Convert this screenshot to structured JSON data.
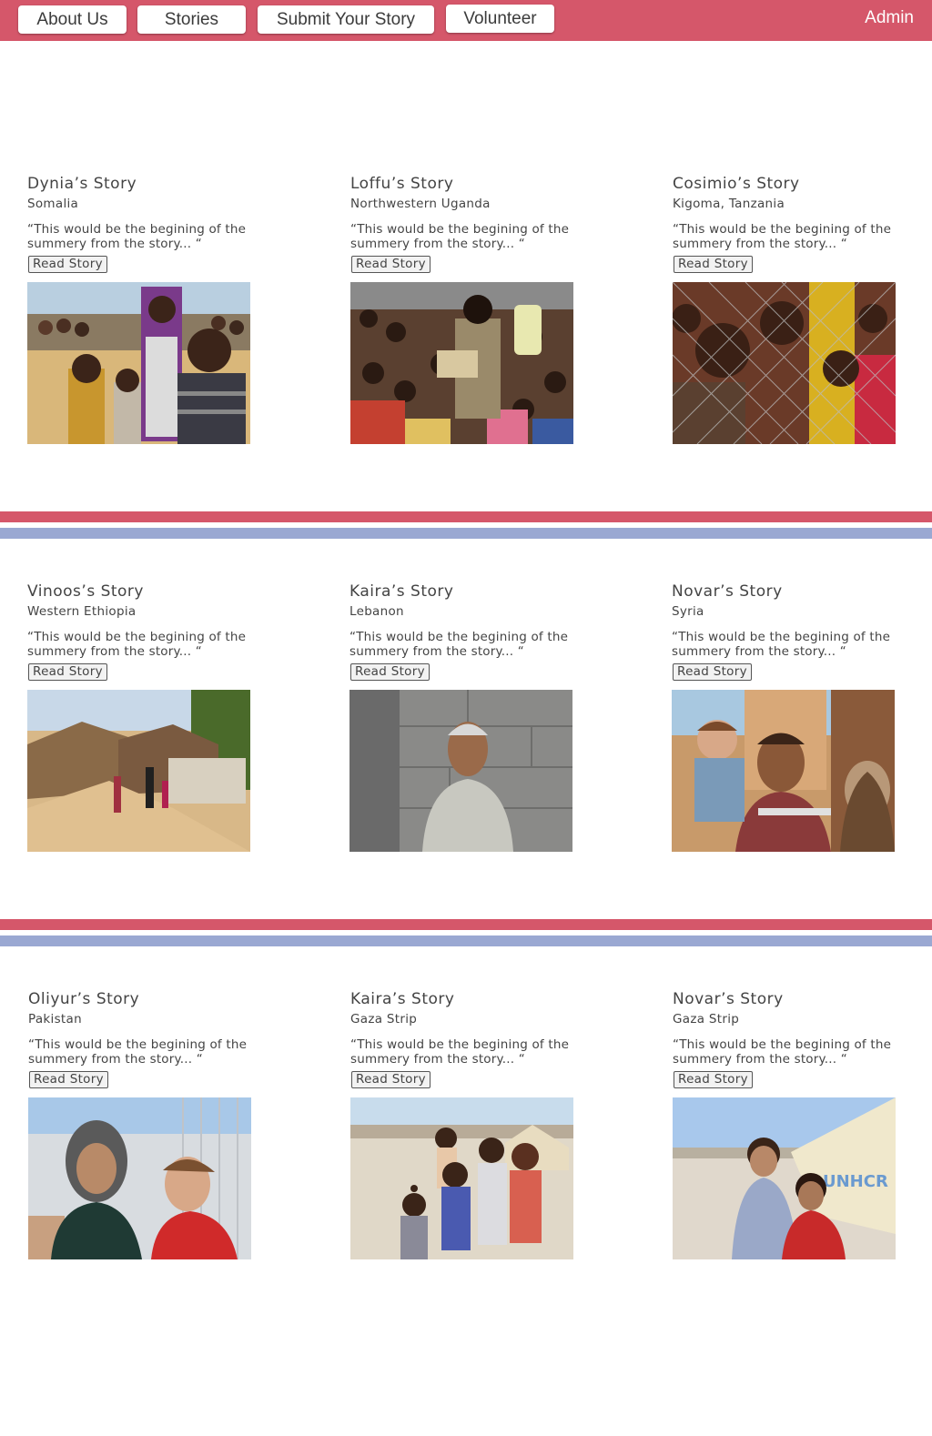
{
  "nav": {
    "items": [
      {
        "label": "About Us"
      },
      {
        "label": "Stories"
      },
      {
        "label": "Submit Your Story"
      },
      {
        "label": "Volunteer"
      }
    ],
    "admin_label": "Admin"
  },
  "colors": {
    "brand": "#d5576a",
    "accent_blue": "#9aa8d2"
  },
  "stories": [
    {
      "title": "Dynia’s Story",
      "location": "Somalia",
      "summary": "“This would be the begining of the summery from the story... “",
      "button": "Read Story",
      "photo": "refugee-children-crowd-photo"
    },
    {
      "title": "Loffu’s Story",
      "location": "Northwestern Uganda",
      "summary": "“This would be the begining of the summery from the story... “",
      "button": "Read Story",
      "photo": "crowd-with-jerrycan-photo"
    },
    {
      "title": "Cosimio’s Story",
      "location": "Kigoma, Tanzania",
      "summary": "“This would be the begining of the summery from the story... “",
      "button": "Read Story",
      "photo": "children-behind-fence-photo"
    },
    {
      "title": "Vinoos’s Story",
      "location": "Western Ethiopia",
      "summary": "“This would be the begining of the summery from the story... “",
      "button": "Read Story",
      "photo": "camp-huts-hillside-photo"
    },
    {
      "title": "Kaira’s Story",
      "location": "Lebanon",
      "summary": "“This would be the begining of the summery from the story... “",
      "button": "Read Story",
      "photo": "elderly-man-wall-photo"
    },
    {
      "title": "Novar’s Story",
      "location": "Syria",
      "summary": "“This would be the begining of the summery from the story... “",
      "button": "Read Story",
      "photo": "father-holding-child-photo"
    },
    {
      "title": "Oliyur’s Story",
      "location": "Pakistan",
      "summary": "“This would be the begining of the summery from the story... “",
      "button": "Read Story",
      "photo": "girl-and-young-child-photo"
    },
    {
      "title": "Kaira’s Story",
      "location": "Gaza Strip",
      "summary": "“This would be the begining of the summery from the story... “",
      "button": "Read Story",
      "photo": "children-group-desert-camp-photo"
    },
    {
      "title": "Novar’s Story",
      "location": "Gaza Strip",
      "summary": "“This would be the begining of the summery from the story... “",
      "button": "Read Story",
      "photo": "two-children-unhcr-tent-photo"
    }
  ]
}
